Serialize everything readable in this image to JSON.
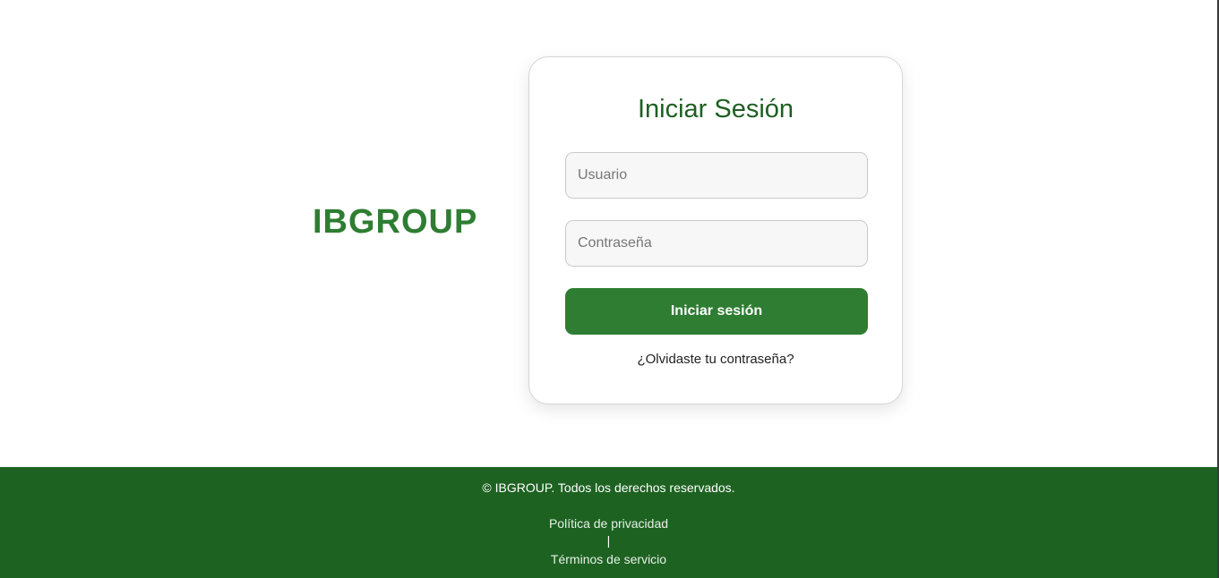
{
  "brand": {
    "name": "IBGROUP",
    "color": "#2e7d32"
  },
  "login": {
    "title": "Iniciar Sesión",
    "username_placeholder": "Usuario",
    "username_value": "",
    "password_placeholder": "Contraseña",
    "password_value": "",
    "submit_label": "Iniciar sesión",
    "forgot_label": "¿Olvidaste tu contraseña?"
  },
  "footer": {
    "copyright": "© IBGROUP. Todos los derechos reservados.",
    "privacy_label": "Política de privacidad",
    "separator": "|",
    "terms_label": "Términos de servicio",
    "background_color": "#1e6222"
  }
}
